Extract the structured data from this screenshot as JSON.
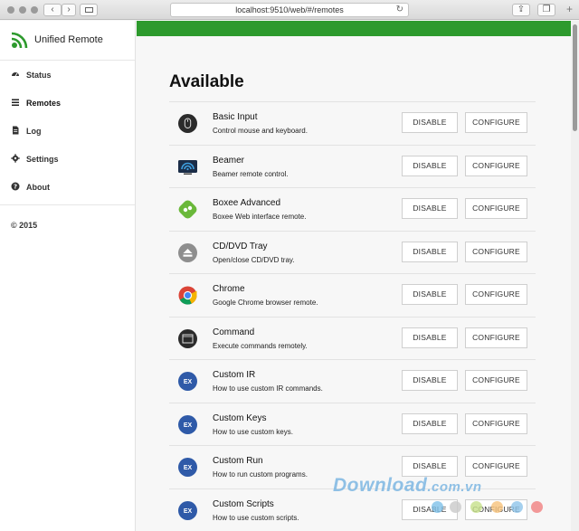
{
  "browser": {
    "url": "localhost:9510/web/#/remotes"
  },
  "app": {
    "name": "Unified Remote",
    "accent": "#2d9a2d"
  },
  "sidebar": {
    "items": [
      {
        "label": "Status",
        "icon": "dashboard-icon"
      },
      {
        "label": "Remotes",
        "icon": "list-icon",
        "active": true
      },
      {
        "label": "Log",
        "icon": "file-icon"
      },
      {
        "label": "Settings",
        "icon": "gear-icon"
      },
      {
        "label": "About",
        "icon": "question-icon"
      }
    ],
    "copyright": "© 2015"
  },
  "main": {
    "title": "Available",
    "buttons": {
      "disable": "DISABLE",
      "configure": "CONFIGURE"
    },
    "remotes": [
      {
        "name": "Basic Input",
        "desc": "Control mouse and keyboard.",
        "icon": "mouse-icon"
      },
      {
        "name": "Beamer",
        "desc": "Beamer remote control.",
        "icon": "beamer-icon"
      },
      {
        "name": "Boxee Advanced",
        "desc": "Boxee Web interface remote.",
        "icon": "boxee-icon"
      },
      {
        "name": "CD/DVD Tray",
        "desc": "Open/close CD/DVD tray.",
        "icon": "eject-icon"
      },
      {
        "name": "Chrome",
        "desc": "Google Chrome browser remote.",
        "icon": "chrome-icon"
      },
      {
        "name": "Command",
        "desc": "Execute commands remotely.",
        "icon": "terminal-icon"
      },
      {
        "name": "Custom IR",
        "desc": "How to use custom IR commands.",
        "icon": "ex-icon"
      },
      {
        "name": "Custom Keys",
        "desc": "How to use custom keys.",
        "icon": "ex-icon"
      },
      {
        "name": "Custom Run",
        "desc": "How to run custom programs.",
        "icon": "ex-icon"
      },
      {
        "name": "Custom Scripts",
        "desc": "How to use custom scripts.",
        "icon": "ex-icon"
      }
    ]
  },
  "watermark": {
    "text": "Download",
    "tld": ".com.vn"
  }
}
